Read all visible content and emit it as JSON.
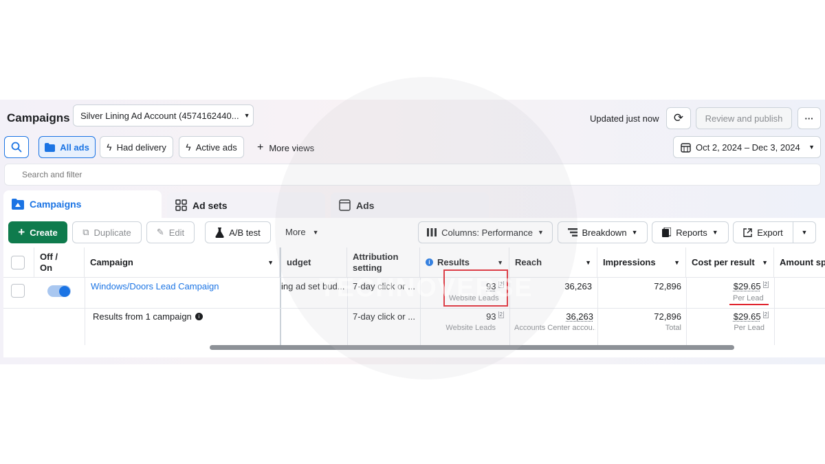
{
  "header": {
    "title": "Campaigns",
    "account_name": "Silver Lining Ad Account (4574162440...",
    "updated_text": "Updated just now",
    "review_label": "Review and publish",
    "more_glyph": "···"
  },
  "filters": {
    "all_ads": "All ads",
    "had_delivery": "Had delivery",
    "active_ads": "Active ads",
    "more_views": "More views",
    "date_range": "Oct 2, 2024 – Dec 3, 2024",
    "search_placeholder": "Search and filter"
  },
  "tabs": [
    {
      "label": "Campaigns"
    },
    {
      "label": "Ad sets"
    },
    {
      "label": "Ads"
    }
  ],
  "toolbar": {
    "create": "Create",
    "duplicate": "Duplicate",
    "edit": "Edit",
    "ab_test": "A/B test",
    "more": "More",
    "columns": "Columns: Performance",
    "breakdown": "Breakdown",
    "reports": "Reports",
    "export": "Export"
  },
  "table": {
    "columns": {
      "off_on_1": "Off /",
      "off_on_2": "On",
      "campaign": "Campaign",
      "budget": "udget",
      "attribution_1": "Attribution",
      "attribution_2": "setting",
      "results": "Results",
      "reach": "Reach",
      "impressions": "Impressions",
      "cost_per_result": "Cost per result",
      "amount_spent": "Amount sp"
    },
    "rows": [
      {
        "campaign": "Windows/Doors Lead Campaign",
        "budget": "ing ad set bud...",
        "attribution": "7-day click or ...",
        "results": "93",
        "results_sub": "Website Leads",
        "reach": "36,263",
        "reach_sub": "",
        "impressions": "72,896",
        "impressions_sub": "",
        "cost": "$29.65",
        "cost_sub": "Per Lead"
      }
    ],
    "summary": {
      "label": "Results from 1 campaign",
      "attribution": "7-day click or ...",
      "results": "93",
      "results_sub": "Website Leads",
      "reach": "36,263",
      "reach_sub": "Accounts Center accou...",
      "impressions": "72,896",
      "impressions_sub": "Total",
      "cost": "$29.65",
      "cost_sub": "Per Lead"
    }
  },
  "watermark": "TECHNOVERSE",
  "colors": {
    "primary": "#1b74e4",
    "create_green": "#0f7b4d",
    "highlight_red": "#e0242e"
  }
}
